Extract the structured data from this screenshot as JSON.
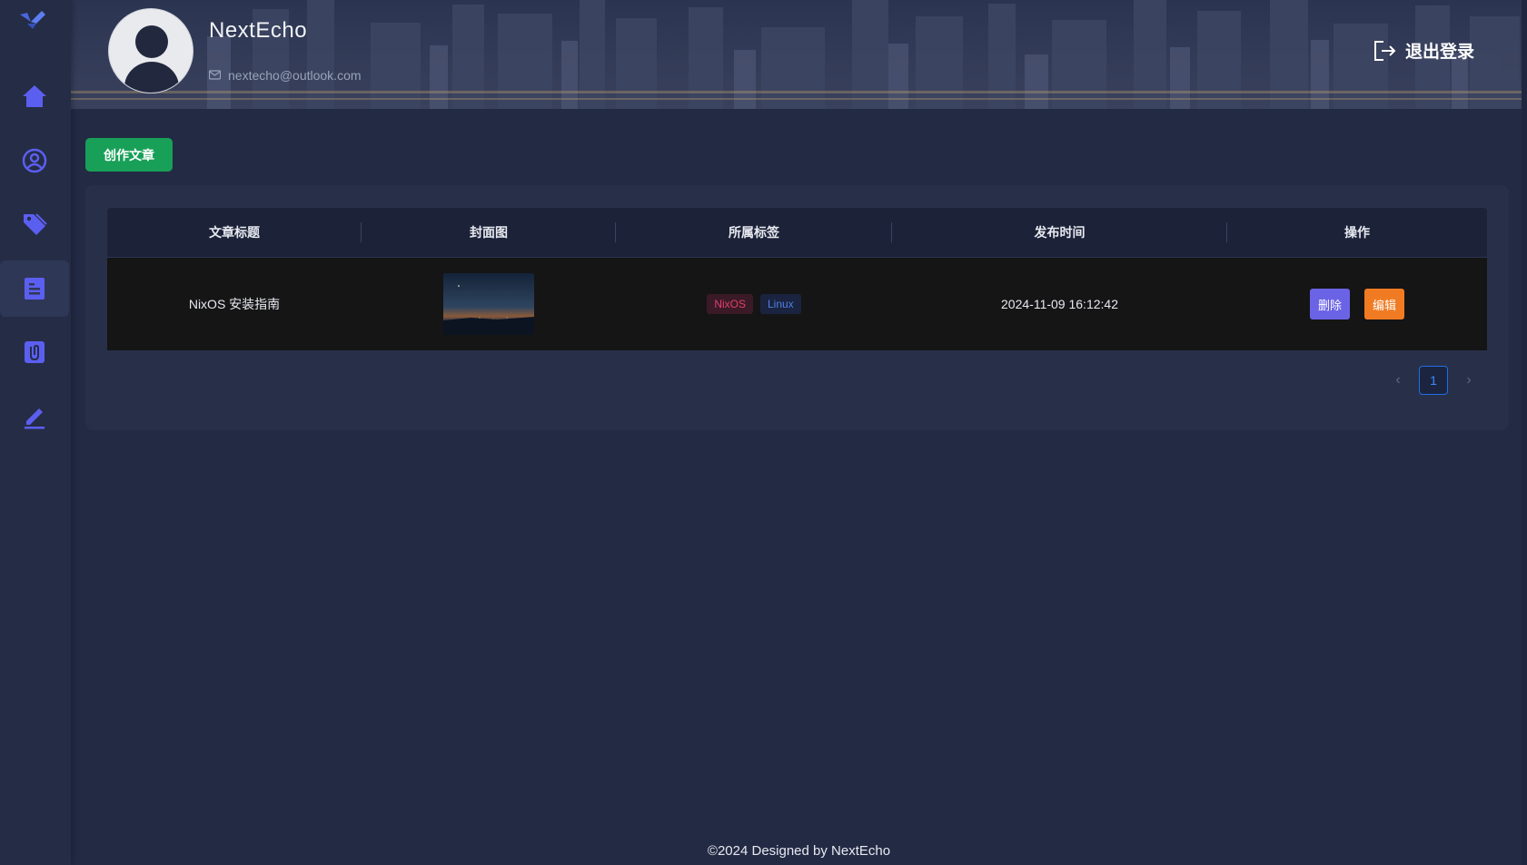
{
  "sidebar": {
    "items": [
      {
        "icon": "home-icon"
      },
      {
        "icon": "user-circle-icon"
      },
      {
        "icon": "tag-icon"
      },
      {
        "icon": "article-icon",
        "active": true
      },
      {
        "icon": "paperclip-icon"
      },
      {
        "icon": "pen-icon"
      }
    ]
  },
  "header": {
    "username": "NextEcho",
    "email": "nextecho@outlook.com",
    "logout_label": "退出登录"
  },
  "toolbar": {
    "create_label": "创作文章"
  },
  "table": {
    "columns": [
      "文章标题",
      "封面图",
      "所属标签",
      "发布时间",
      "操作"
    ],
    "rows": [
      {
        "title": "NixOS 安装指南",
        "tags": [
          "NixOS",
          "Linux"
        ],
        "published": "2024-11-09 16:12:42",
        "delete_label": "删除",
        "edit_label": "编辑"
      }
    ]
  },
  "pagination": {
    "current": "1",
    "prev": "‹",
    "next": "›"
  },
  "footer": {
    "text": "©2024 Designed by NextEcho"
  },
  "colors": {
    "accent": "#5b5ff0",
    "success": "#18a058",
    "warning": "#f07b22",
    "primary_blue": "#3b8bff"
  }
}
